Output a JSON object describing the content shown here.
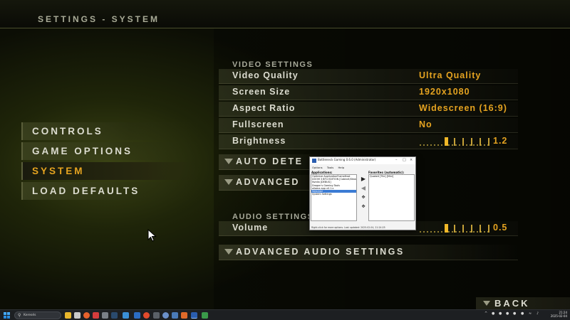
{
  "header": {
    "title": "SETTINGS - SYSTEM"
  },
  "left_menu": {
    "items": [
      {
        "label": "CONTROLS",
        "active": false
      },
      {
        "label": "GAME OPTIONS",
        "active": false
      },
      {
        "label": "SYSTEM",
        "active": true
      },
      {
        "label": "LOAD DEFAULTS",
        "active": false
      }
    ]
  },
  "video": {
    "section_label": "VIDEO SETTINGS",
    "quality": {
      "label": "Video Quality",
      "value": "Ultra Quality"
    },
    "screen_size": {
      "label": "Screen Size",
      "value": "1920x1080"
    },
    "aspect_ratio": {
      "label": "Aspect Ratio",
      "value": "Widescreen (16:9)"
    },
    "fullscreen": {
      "label": "Fullscreen",
      "value": "No"
    },
    "brightness": {
      "label": "Brightness",
      "value": "1.2",
      "level_fraction": 0.37
    },
    "auto_detect_label": "AUTO DETE",
    "advanced_label": "ADVANCED"
  },
  "audio": {
    "section_label": "AUDIO SETTINGS",
    "volume": {
      "label": "Volume",
      "value": "0.5",
      "level_fraction": 0.37
    },
    "advanced_label": "ADVANCED AUDIO SETTINGS"
  },
  "back_label": "BACK",
  "popup": {
    "title": "Bottleneck Gaming 0.6.0 (Administrator)",
    "menu": [
      "Options",
      "Tools",
      "Help"
    ],
    "applications_label": "Applications:",
    "favorites_label": "Favorites (automatic):",
    "applications": [
      "Optimize ApplicationFrameHost",
      "DOOM 3 BFG EDITION [Cabinet/Steam]",
      "Nvidia [DEBUG]",
      "Dragon's Gaming Tools",
      "ollama app v0.1.x",
      "Selected",
      "System Settings"
    ],
    "selected_index": 5,
    "favorites": [
      "Quake4 [Tile] [Mini]"
    ],
    "status": "Right-click for more options. Last updated: 2025.02.04, 21:24:25"
  },
  "taskbar": {
    "search_placeholder": "Keresés",
    "time": "21:24",
    "date": "2025-02-04"
  },
  "colors": {
    "accent": "#e5a320",
    "text": "#dcdcd0",
    "bg": "#1f2509"
  }
}
